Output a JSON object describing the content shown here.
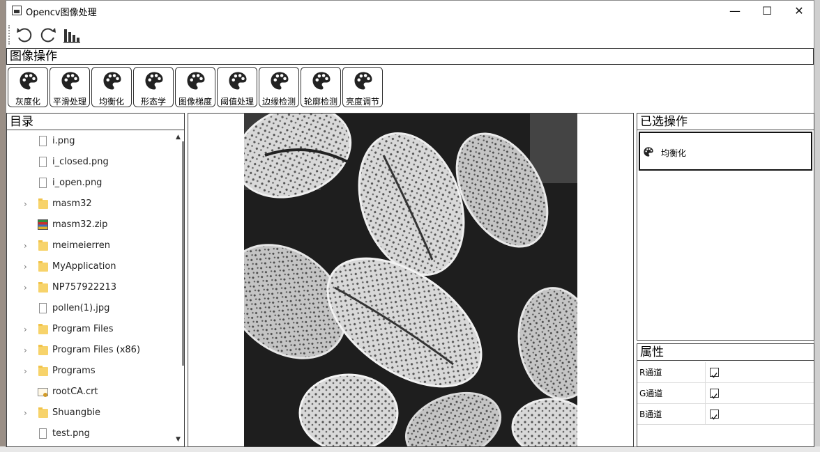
{
  "window": {
    "title": "Opencv图像处理",
    "minimize_label": "—",
    "maximize_label": "☐",
    "close_label": "✕"
  },
  "toolbar": {
    "buttons": [
      {
        "name": "undo",
        "icon": "undo-icon"
      },
      {
        "name": "redo",
        "icon": "redo-icon"
      },
      {
        "name": "histogram",
        "icon": "bar-chart-icon"
      }
    ]
  },
  "operations": {
    "title": "图像操作",
    "items": [
      {
        "label": "灰度化",
        "icon": "palette-icon"
      },
      {
        "label": "平滑处理",
        "icon": "palette-icon"
      },
      {
        "label": "均衡化",
        "icon": "palette-icon"
      },
      {
        "label": "形态学",
        "icon": "palette-icon"
      },
      {
        "label": "图像梯度",
        "icon": "palette-icon"
      },
      {
        "label": "阈值处理",
        "icon": "palette-icon"
      },
      {
        "label": "边缘检测",
        "icon": "palette-icon"
      },
      {
        "label": "轮廓检测",
        "icon": "palette-icon"
      },
      {
        "label": "亮度调节",
        "icon": "palette-icon"
      }
    ]
  },
  "directory": {
    "title": "目录",
    "items": [
      {
        "name": "i.png",
        "type": "file",
        "expandable": false
      },
      {
        "name": "i_closed.png",
        "type": "file",
        "expandable": false
      },
      {
        "name": "i_open.png",
        "type": "file",
        "expandable": false
      },
      {
        "name": "masm32",
        "type": "folder",
        "expandable": true
      },
      {
        "name": "masm32.zip",
        "type": "zip",
        "expandable": false
      },
      {
        "name": "meimeierren",
        "type": "folder",
        "expandable": true
      },
      {
        "name": "MyApplication",
        "type": "folder",
        "expandable": true
      },
      {
        "name": "NP757922213",
        "type": "folder",
        "expandable": true
      },
      {
        "name": "pollen(1).jpg",
        "type": "file",
        "expandable": false
      },
      {
        "name": "Program Files",
        "type": "folder",
        "expandable": true
      },
      {
        "name": "Program Files (x86)",
        "type": "folder",
        "expandable": true
      },
      {
        "name": "Programs",
        "type": "folder",
        "expandable": true
      },
      {
        "name": "rootCA.crt",
        "type": "cert",
        "expandable": false
      },
      {
        "name": "Shuangbie",
        "type": "folder",
        "expandable": true
      },
      {
        "name": "test.png",
        "type": "file",
        "expandable": false
      }
    ]
  },
  "selected_ops": {
    "title": "已选操作",
    "items": [
      {
        "label": "均衡化",
        "icon": "palette-icon"
      }
    ]
  },
  "properties": {
    "title": "属性",
    "rows": [
      {
        "label": "R通道",
        "checked": true
      },
      {
        "label": "G通道",
        "checked": true
      },
      {
        "label": "B通道",
        "checked": true
      }
    ]
  }
}
